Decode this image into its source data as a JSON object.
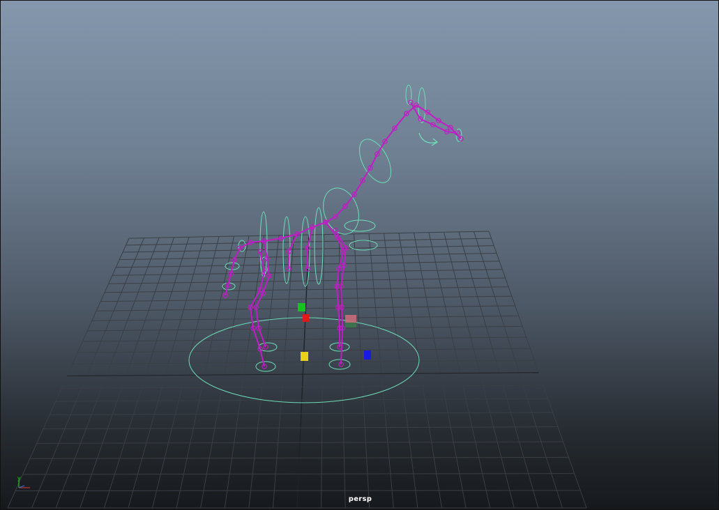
{
  "viewport": {
    "camera_name": "persp",
    "background_top": "#8497ac",
    "background_bottom": "#16191c"
  },
  "axis_gizmo": {
    "y_label": "y",
    "x_label": "x",
    "z_label": "z"
  },
  "colors": {
    "grid": "#3a3f45",
    "grid_axis": "#1f2226",
    "joints": "#c21cc7",
    "nurbs_controls": "#6de0b8",
    "green_handle": "#18c21c",
    "red_handle": "#e01818",
    "yellow_handle": "#e8d21a",
    "blue_handle": "#1a1ae0",
    "pink_handle": "#c86a7a"
  },
  "icons": [
    "axis-gizmo-icon"
  ]
}
